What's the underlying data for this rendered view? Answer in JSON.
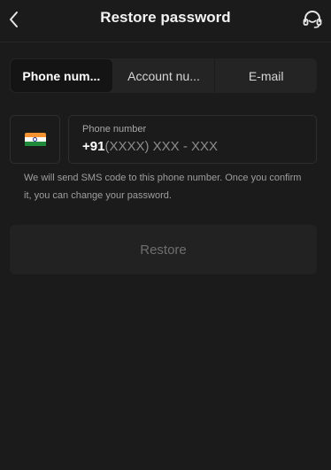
{
  "header": {
    "title": "Restore password",
    "back_icon": "chevron-left-icon",
    "support_icon": "headset-icon"
  },
  "tabs": [
    {
      "label": "Phone num...",
      "active": true
    },
    {
      "label": "Account nu...",
      "active": false
    },
    {
      "label": "E-mail",
      "active": false
    }
  ],
  "phone": {
    "country_flag": "india-flag-icon",
    "label": "Phone number",
    "code": "+91",
    "mask": "(XXXX) XXX - XXX"
  },
  "hint": "We will send SMS code to this phone number. Once you confirm it, you can change your password.",
  "restore_button": {
    "label": "Restore",
    "enabled": false
  },
  "colors": {
    "background": "#1b1b1b",
    "tab_bar": "#242424",
    "active_tab": "#141414",
    "border": "#2e2e2e",
    "button": "#222222",
    "button_text_disabled": "#6e6e6e"
  }
}
